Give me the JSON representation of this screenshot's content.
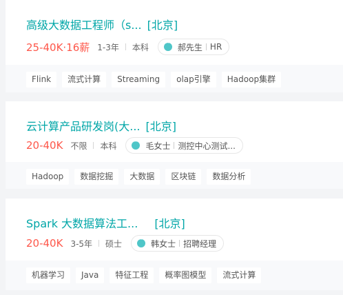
{
  "jobs": [
    {
      "title": "高级大数据工程师（s...",
      "city": "[北京]",
      "salary": "25-40K·16薪",
      "experience": "1-3年",
      "education": "本科",
      "contact_name": "郝先生",
      "contact_role": "HR",
      "tags": [
        "Flink",
        "流式计算",
        "Streaming",
        "olap引擎",
        "Hadoop集群"
      ]
    },
    {
      "title": "云计算产品研发岗(大...",
      "city": "[北京]",
      "salary": "20-40K",
      "experience": "不限",
      "education": "本科",
      "contact_name": "毛女士",
      "contact_role": "测控中心测试...",
      "tags": [
        "Hadoop",
        "数据挖掘",
        "大数据",
        "区块链",
        "数据分析"
      ]
    },
    {
      "title": "Spark 大数据算法工...",
      "city": "[北京]",
      "salary": "20-40K",
      "experience": "3-5年",
      "education": "硕士",
      "contact_name": "韩女士",
      "contact_role": "招聘经理",
      "tags": [
        "机器学习",
        "Java",
        "特征工程",
        "概率图模型",
        "流式计算"
      ]
    }
  ],
  "icons": {
    "contact": "chat-bubble-icon"
  },
  "colors": {
    "title": "#00a6a7",
    "salary": "#fe574a",
    "icon": "#4fc6c8"
  }
}
